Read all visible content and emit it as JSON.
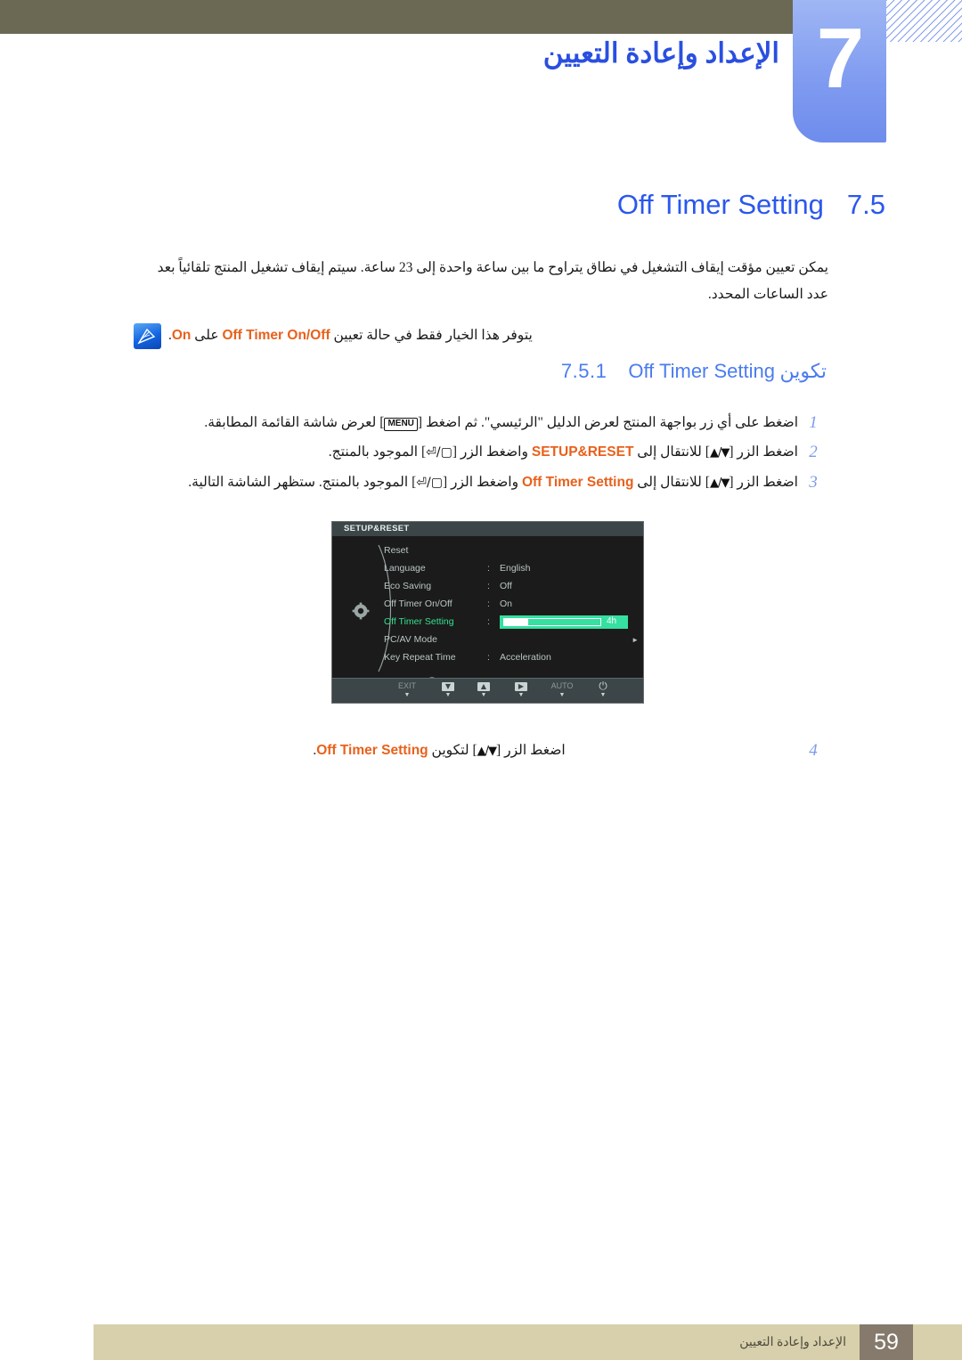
{
  "header": {
    "chapter_number": "7",
    "chapter_title": "الإعداد وإعادة التعيين",
    "bar_color": "#6b6954",
    "chapter_box_color": "#7e9af0"
  },
  "section": {
    "number": "7.5",
    "name": "Off Timer Setting",
    "color": "#2a57ee"
  },
  "intro": {
    "text": "يمكن تعيين مؤقت إيقاف التشغيل في نطاق يتراوح ما بين ساعة واحدة إلى 23 ساعة. سيتم إيقاف تشغيل المنتج تلقائياً بعد عدد الساعات المحدد."
  },
  "note": {
    "icon": "note-pencil-icon",
    "text_before": "يتوفر هذا الخيار فقط في حالة تعيين",
    "highlight1": "Off Timer On/Off",
    "text_middle": "على",
    "highlight2": "On",
    "text_after": ".",
    "highlight_color": "#e8611c"
  },
  "subsection": {
    "number": "7.5.1",
    "name_arabic": "تكوين",
    "name_latin": "Off Timer Setting",
    "color": "#4b7cf0"
  },
  "steps": [
    {
      "number": "1",
      "part_a": "اضغط على أي زر بواجهة المنتج لعرض الدليل \"الرئيسي\". ثم اضغط",
      "key": "MENU",
      "part_b": "لعرض شاشة القائمة المطابقة."
    },
    {
      "number": "2",
      "part_a": "اضغط الزر",
      "key1": "▲/▼",
      "part_b": "للانتقال إلى",
      "menu": "SETUP&RESET",
      "part_c": "واضغط الزر",
      "key2": "⏎/▢",
      "part_d": "الموجود بالمنتج."
    },
    {
      "number": "3",
      "part_a": "اضغط الزر",
      "key1": "▲/▼",
      "part_b": "للانتقال إلى",
      "menu": "Off Timer Setting",
      "part_c": "واضغط الزر",
      "key2": "⏎/▢",
      "part_d": "الموجود بالمنتج. ستظهر الشاشة التالية."
    },
    {
      "number": "4",
      "part_a": "اضغط الزر",
      "key1": "▲/▼",
      "part_b": "لتكوين",
      "menu": "Off Timer Setting",
      "part_c": "."
    }
  ],
  "osd": {
    "tab_label": "SETUP&RESET",
    "gear_icon": "gear-icon",
    "rows": [
      {
        "label": "Reset",
        "colon": "",
        "value": "",
        "type": "plain",
        "selected": false
      },
      {
        "label": "Language",
        "colon": ":",
        "value": "English",
        "type": "plain",
        "selected": false
      },
      {
        "label": "Eco Saving",
        "colon": ":",
        "value": "Off",
        "type": "plain",
        "selected": false
      },
      {
        "label": "Off Timer On/Off",
        "colon": ":",
        "value": "On",
        "type": "plain",
        "selected": false
      },
      {
        "label": "Off Timer Setting",
        "colon": ":",
        "value": "4h",
        "type": "slider",
        "selected": true,
        "slider_percent": 25
      },
      {
        "label": "PC/AV Mode",
        "colon": "",
        "value": "",
        "type": "submenu",
        "selected": false
      },
      {
        "label": "Key Repeat Time",
        "colon": ":",
        "value": "Acceleration",
        "type": "plain",
        "selected": false
      }
    ],
    "scroll_hint": "▼",
    "footer_buttons": [
      {
        "label": "EXIT",
        "glyph": "",
        "kind": "text",
        "dim": true
      },
      {
        "label": "",
        "glyph": "▼",
        "kind": "box",
        "dim": false
      },
      {
        "label": "",
        "glyph": "▲",
        "kind": "box",
        "dim": false
      },
      {
        "label": "",
        "glyph": "▶",
        "kind": "box",
        "dim": false
      },
      {
        "label": "AUTO",
        "glyph": "",
        "kind": "text",
        "dim": true
      },
      {
        "label": "",
        "glyph": "⏻",
        "kind": "text",
        "dim": false
      }
    ],
    "highlight_color": "#35e0a0",
    "selected_label_color": "#35e08f",
    "background_color": "#1b1b1b",
    "bar_color": "#3c4547"
  },
  "footer": {
    "page_number": "59",
    "chapter_title": "الإعداد وإعادة التعيين",
    "bar_color": "#d8d0ac",
    "page_box_color": "#857a6b"
  }
}
